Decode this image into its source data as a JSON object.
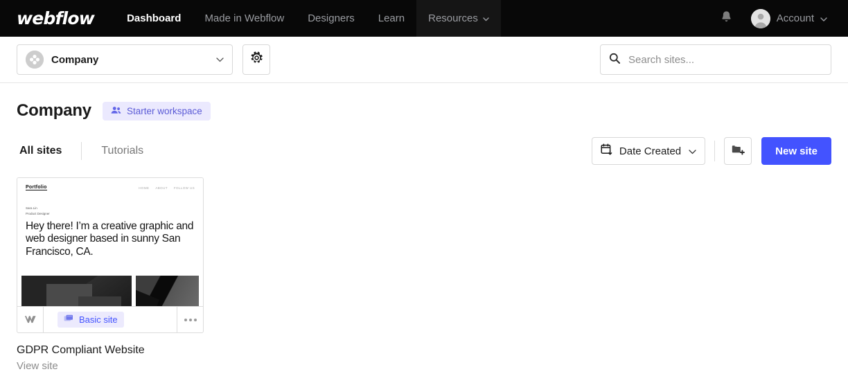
{
  "nav": {
    "logo": "webflow",
    "links": [
      {
        "label": "Dashboard",
        "state": "active"
      },
      {
        "label": "Made in Webflow",
        "state": "default"
      },
      {
        "label": "Designers",
        "state": "default"
      },
      {
        "label": "Learn",
        "state": "default"
      },
      {
        "label": "Resources",
        "state": "hovered",
        "has_chevron": true
      }
    ],
    "bell_icon": "bell-icon",
    "account": {
      "label": "Account",
      "avatar_icon": "user-avatar-icon",
      "chevron": "chevron-down-icon"
    }
  },
  "toolbar": {
    "workspace": {
      "name": "Company",
      "avatar_icon": "workspace-avatar-icon",
      "chevron": "chevron-down-icon"
    },
    "settings_icon": "gear-icon",
    "search": {
      "placeholder": "Search sites...",
      "value": "",
      "icon": "search-icon"
    }
  },
  "page": {
    "title": "Company",
    "workspace_badge": {
      "label": "Starter workspace",
      "icon": "people-icon"
    },
    "tabs": [
      {
        "label": "All sites",
        "active": true
      },
      {
        "label": "Tutorials",
        "active": false
      }
    ],
    "actions": {
      "sort": {
        "label": "Date Created",
        "icon": "calendar-sort-icon",
        "chevron": "chevron-down-icon"
      },
      "new_folder": {
        "label": "",
        "icon": "new-folder-icon"
      },
      "new_site": {
        "label": "New site"
      }
    }
  },
  "sites": [
    {
      "title": "GDPR Compliant Website",
      "link_label": "View site",
      "badge": {
        "label": "Basic site",
        "icon": "site-plan-icon"
      },
      "logo_icon": "webflow-mark-icon",
      "menu_icon": "more-options-icon",
      "thumbnail": {
        "logo": "Portfolio",
        "nav": [
          "HOME",
          "ABOUT",
          "FOLLOW US"
        ],
        "name": "Sara Lin",
        "role": "Product Designer",
        "headline": "Hey there! I’m a creative graphic and web designer based in sunny San Francisco, CA."
      }
    }
  ],
  "colors": {
    "nav_bg": "#080808",
    "accent_blue": "#4353FF",
    "badge_purple_text": "#5B5BD6",
    "badge_purple_bg": "#EBE9FE",
    "border": "#DCDCDC"
  }
}
